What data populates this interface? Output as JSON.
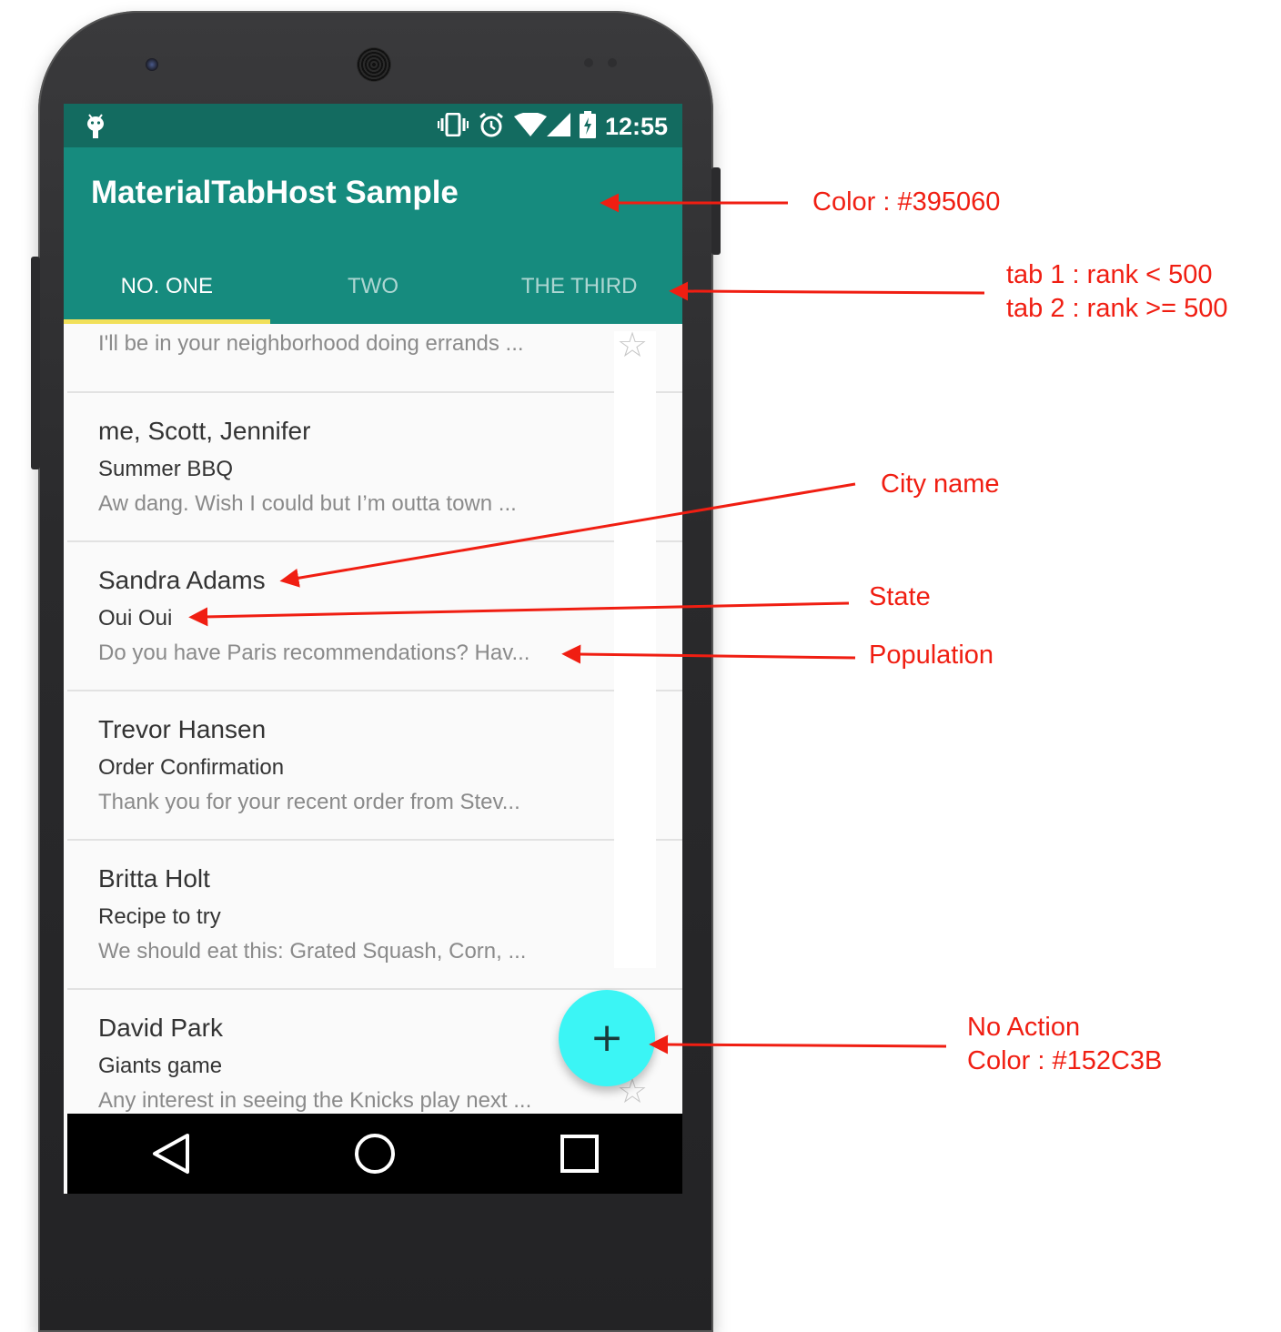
{
  "status_bar": {
    "time": "12:55",
    "icons": [
      "android-debug-icon",
      "vibrate-icon",
      "alarm-icon",
      "wifi-icon",
      "signal-icon",
      "battery-charging-icon"
    ]
  },
  "app_bar": {
    "title": "MaterialTabHost Sample",
    "color": "#168b7e"
  },
  "tabs": [
    {
      "label": "NO. ONE",
      "active": true
    },
    {
      "label": "TWO",
      "active": false
    },
    {
      "label": "THE THIRD",
      "active": false
    }
  ],
  "list": [
    {
      "name": "",
      "subject": "",
      "preview": "I'll be in your neighborhood doing errands ..."
    },
    {
      "name": "me, Scott, Jennifer",
      "subject": "Summer BBQ",
      "preview": "Aw dang. Wish I could but I’m outta town ..."
    },
    {
      "name": "Sandra Adams",
      "subject": "Oui Oui",
      "preview": "Do you have Paris recommendations? Hav..."
    },
    {
      "name": "Trevor Hansen",
      "subject": "Order Confirmation",
      "preview": "Thank you for your recent order from Stev..."
    },
    {
      "name": "Britta Holt",
      "subject": "Recipe to try",
      "preview": "We should eat this: Grated Squash, Corn, ..."
    },
    {
      "name": "David Park",
      "subject": "Giants game",
      "preview": "Any interest in seeing the Knicks play next ..."
    }
  ],
  "fab": {
    "label": "+",
    "color": "#3bf5f5"
  },
  "nav_bar": {
    "buttons": [
      "back-icon",
      "home-icon",
      "recents-icon"
    ]
  },
  "annotations": {
    "color_label": "Color : #395060",
    "tab_rule_1": "tab 1 :  rank < 500",
    "tab_rule_2": "tab 2 :  rank >= 500",
    "city_name": "City name",
    "state": "State",
    "population": "Population",
    "no_action": "No Action",
    "fab_color": "Color : #152C3B"
  }
}
